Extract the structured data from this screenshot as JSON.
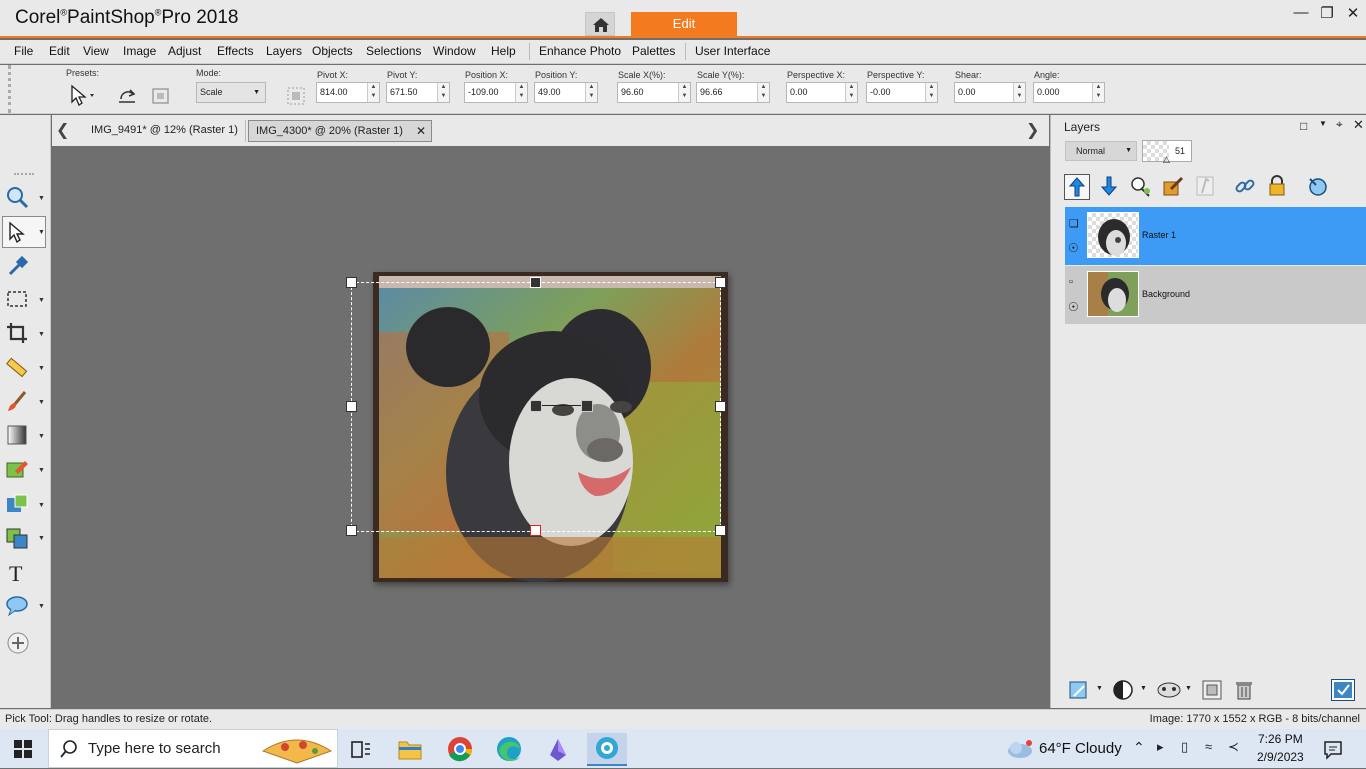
{
  "app": {
    "title_brand": "Corel",
    "title_mark1": "®",
    "title_name": "PaintShop",
    "title_mark2": "®",
    "title_rest": "Pro 2018",
    "workspace_tab": "Edit",
    "accent": "#f47a20"
  },
  "menu": [
    "File",
    "Edit",
    "View",
    "Image",
    "Adjust",
    "Effects",
    "Layers",
    "Objects",
    "Selections",
    "Window",
    "Help",
    "Enhance Photo",
    "Palettes",
    "User Interface"
  ],
  "tool_options": {
    "presets_label": "Presets:",
    "mode_label": "Mode:",
    "mode_value": "Scale",
    "pivot_x_label": "Pivot X:",
    "pivot_x": "814.00",
    "pivot_y_label": "Pivot Y:",
    "pivot_y": "671.50",
    "position_x_label": "Position X:",
    "position_x": "-109.00",
    "position_y_label": "Position Y:",
    "position_y": "49.00",
    "scale_x_label": "Scale X(%):",
    "scale_x": "96.60",
    "scale_y_label": "Scale Y(%):",
    "scale_y": "96.66",
    "persp_x_label": "Perspective X:",
    "persp_x": "0.00",
    "persp_y_label": "Perspective Y:",
    "persp_y": "-0.00",
    "shear_label": "Shear:",
    "shear": "0.00",
    "angle_label": "Angle:",
    "angle": "0.000"
  },
  "doc_tabs": [
    {
      "label": "IMG_9491* @  12% (Raster 1)"
    },
    {
      "label": "IMG_4300* @  20% (Raster 1)"
    }
  ],
  "tools": [
    "zoom-icon",
    "pick-icon",
    "dropper-icon",
    "selection-icon",
    "crop-icon",
    "straighten-icon",
    "paint-brush-icon",
    "gradient-icon",
    "eraser-icon",
    "picture-tube-icon",
    "clone-icon",
    "text-icon",
    "preset-shape-icon",
    "add-tool-icon"
  ],
  "layers_panel": {
    "title": "Layers",
    "blend_mode": "Normal",
    "opacity": "51",
    "layers": [
      {
        "name": "Raster 1",
        "selected": true
      },
      {
        "name": "Background",
        "selected": false
      }
    ],
    "selected_color": "#3d9bf5"
  },
  "status": {
    "left": "Pick Tool: Drag handles to resize or rotate.",
    "right": "Image:  1770 x 1552 x RGB - 8 bits/channel"
  },
  "taskbar": {
    "search_placeholder": "Type here to search",
    "weather": "64°F  Cloudy",
    "time": "7:26 PM",
    "date": "2/9/2023"
  }
}
